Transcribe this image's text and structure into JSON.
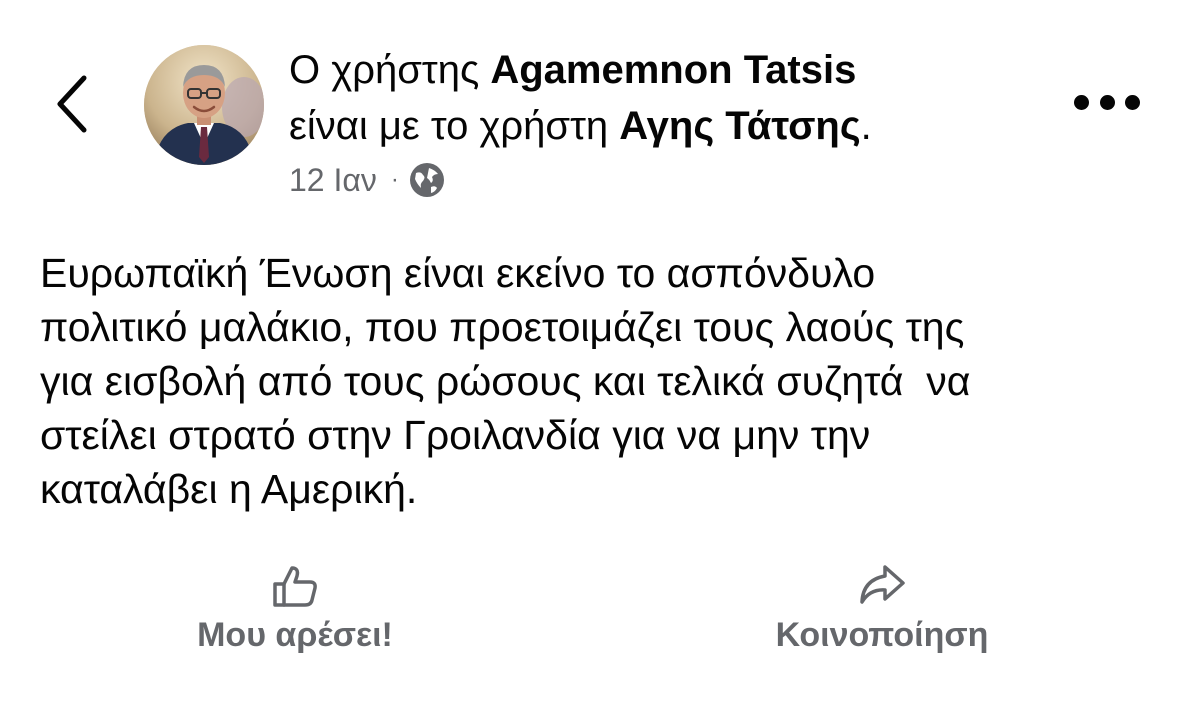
{
  "header": {
    "back_icon": "chevron-left-icon",
    "line1_prefix": "Ο χρήστης ",
    "author_name": "Agamemnon Tatsis",
    "line2_prefix": "είναι με το χρήστη ",
    "tagged_name": "Αγης Τάτσης",
    "line2_suffix": ".",
    "timestamp": "12 Ιαν",
    "separator": "·",
    "privacy_icon": "globe-icon",
    "more_icon": "more-horizontal-icon"
  },
  "post": {
    "lines": [
      "Ευρωπαϊκή Ένωση είναι εκείνο το ασπόνδυλο",
      "πολιτικό μαλάκιο, που προετοιμάζει τους λαούς της",
      "για εισβολή από τους ρώσους και τελικά συζητά  να",
      "στείλει στρατό στην Γροιλανδία για να μην την",
      "καταλάβει η Αμερική."
    ]
  },
  "actions": {
    "like_label": "Μου αρέσει!",
    "like_icon": "thumbs-up-icon",
    "share_label": "Κοινοποίηση",
    "share_icon": "share-arrow-icon"
  },
  "colors": {
    "text_primary": "#050505",
    "text_secondary": "#65676b",
    "background": "#ffffff"
  }
}
